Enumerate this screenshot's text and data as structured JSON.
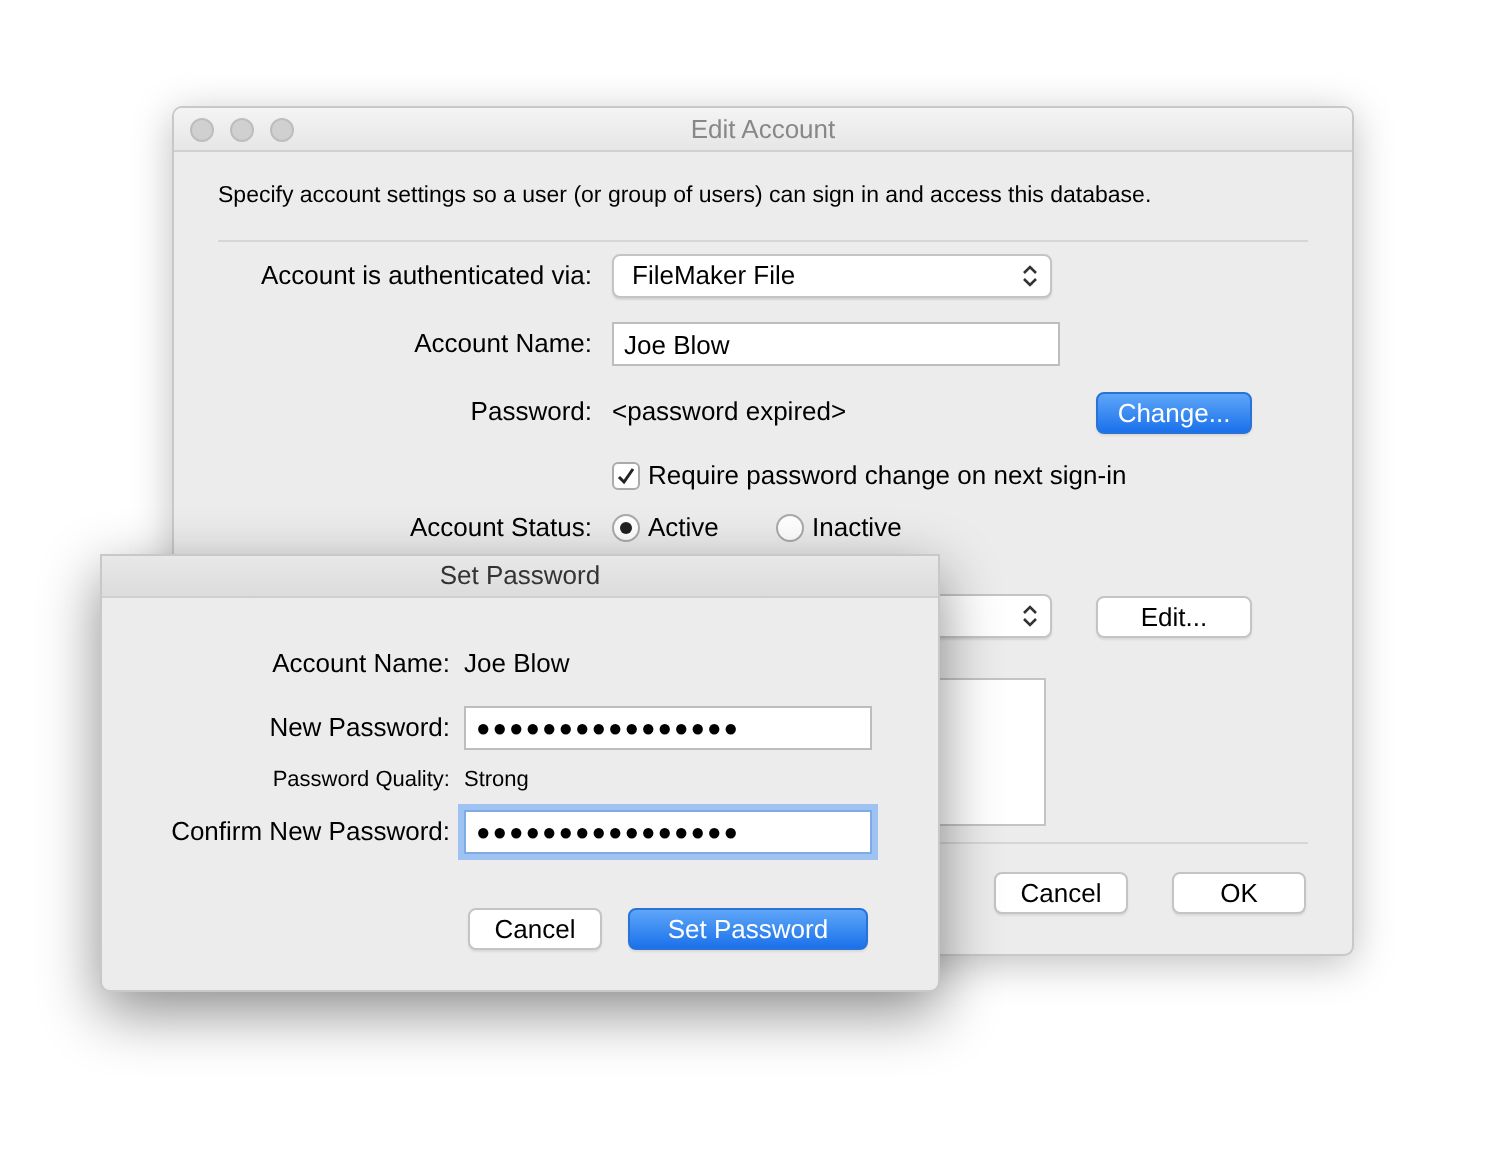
{
  "edit_account": {
    "title": "Edit Account",
    "description": "Specify account settings so a user (or group of users) can sign in and access this database.",
    "authenticated_via": {
      "label": "Account is authenticated via:",
      "value": "FileMaker File"
    },
    "account_name": {
      "label": "Account Name:",
      "value": "Joe Blow"
    },
    "password": {
      "label": "Password:",
      "value": "<password expired>",
      "button": {
        "label": "Change...",
        "default": true
      }
    },
    "require_change": {
      "label": "Require password change on next sign-in",
      "checked": true
    },
    "account_status": {
      "label": "Account Status:",
      "options": [
        {
          "label": "Active",
          "selected": true
        },
        {
          "label": "Inactive",
          "selected": false
        }
      ]
    },
    "edit_button": {
      "label": "Edit...",
      "default": false
    },
    "buttons": [
      {
        "label": "Cancel",
        "default": false
      },
      {
        "label": "OK",
        "default": false
      }
    ]
  },
  "set_password": {
    "title": "Set Password",
    "account_name": {
      "label": "Account Name:",
      "value": "Joe Blow"
    },
    "new_password": {
      "label": "New Password:",
      "value": "●●●●●●●●●●●●●●●●",
      "focused": false
    },
    "quality": {
      "label": "Password Quality:",
      "value": "Strong"
    },
    "confirm_password": {
      "label": "Confirm New Password:",
      "value": "●●●●●●●●●●●●●●●●",
      "focused": true
    },
    "buttons": [
      {
        "label": "Cancel",
        "default": false
      },
      {
        "label": "Set Password",
        "default": true
      }
    ]
  }
}
